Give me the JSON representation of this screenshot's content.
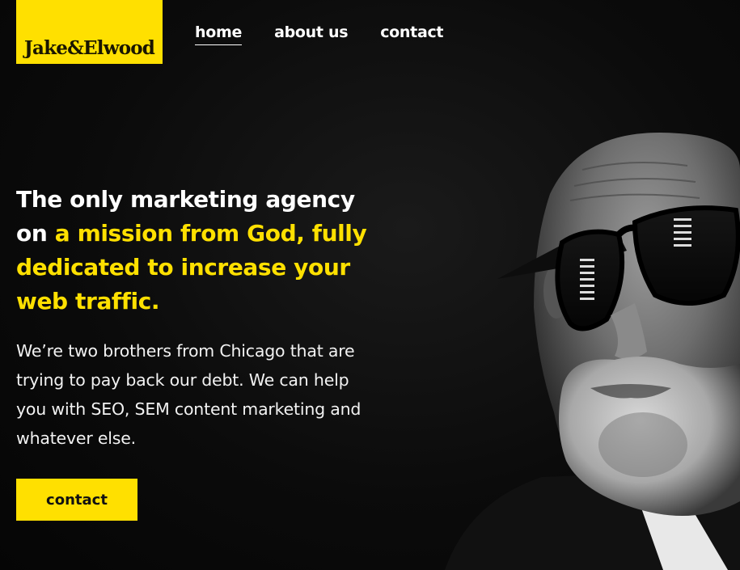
{
  "brand": {
    "logo_text": "Jake&Elwood",
    "accent_color": "#ffe000",
    "background_color": "#0b0b0b"
  },
  "nav": {
    "items": [
      {
        "label": "home",
        "active": true
      },
      {
        "label": "about us",
        "active": false
      },
      {
        "label": "contact",
        "active": false
      }
    ]
  },
  "hero": {
    "headline_white_1": "The only marketing agency on",
    "headline_yellow": "a mission from God, fully dedicated to increase your web traffic.",
    "body": "We’re two brothers from Chicago that are trying to pay back our debt. We can help you with SEO, SEM content marketing and whatever else.",
    "cta_label": "contact"
  },
  "image": {
    "subject": "bald-man-sunglasses-portrait-image"
  }
}
